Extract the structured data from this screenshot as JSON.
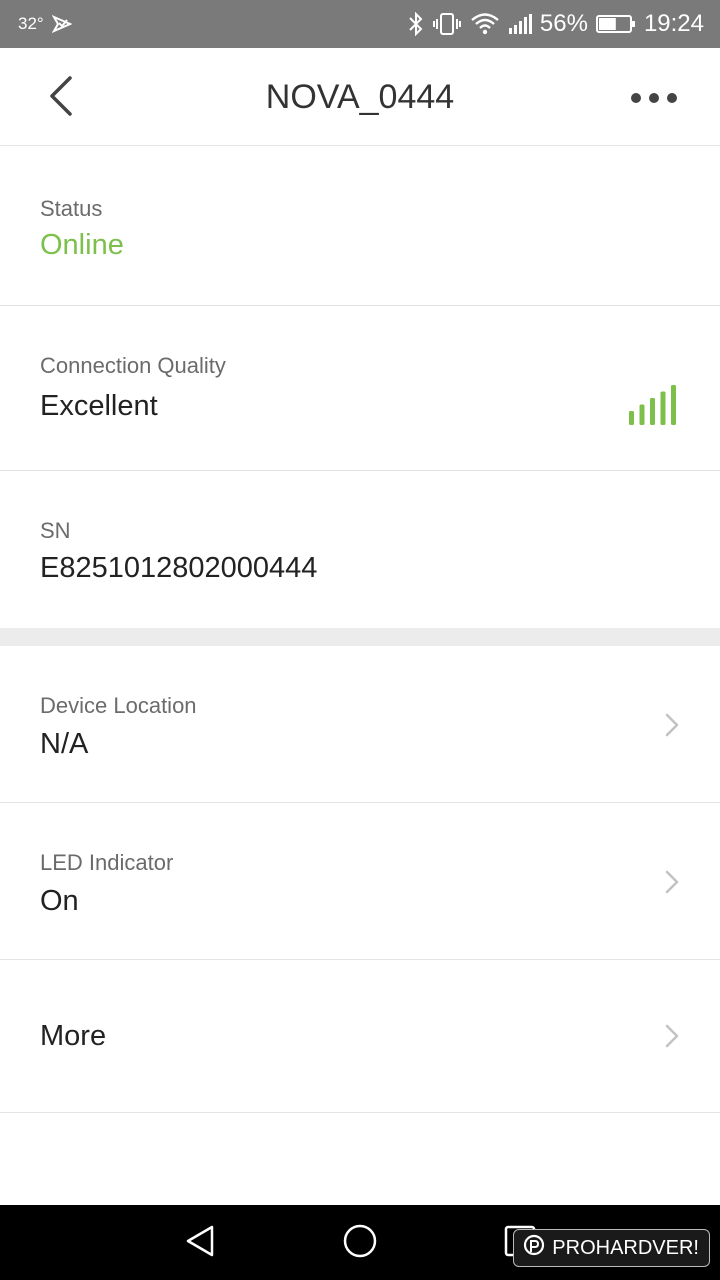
{
  "status_bar": {
    "temperature": "32°",
    "battery_percent": "56%",
    "time": "19:24",
    "battery_level": 0.56,
    "icons": [
      "notification-icon",
      "bluetooth-icon",
      "vibrate-icon",
      "wifi-icon",
      "signal-icon",
      "battery-icon"
    ]
  },
  "header": {
    "title": "NOVA_0444",
    "back_icon": "chevron-left-icon",
    "more_icon": "more-dots-icon"
  },
  "rows": {
    "status": {
      "label": "Status",
      "value": "Online",
      "value_color": "#7cc04b"
    },
    "connection_quality": {
      "label": "Connection Quality",
      "value": "Excellent",
      "signal_bars": 5,
      "signal_color": "#7cc04b"
    },
    "sn": {
      "label": "SN",
      "value": "E8251012802000444"
    },
    "device_location": {
      "label": "Device Location",
      "value": "N/A"
    },
    "led_indicator": {
      "label": "LED Indicator",
      "value": "On"
    },
    "more": {
      "label": "More"
    }
  },
  "nav_bar": {
    "icons": [
      "back-triangle-icon",
      "home-circle-icon",
      "recents-square-icon"
    ]
  },
  "watermark": {
    "text": "PROHARDVER!"
  }
}
